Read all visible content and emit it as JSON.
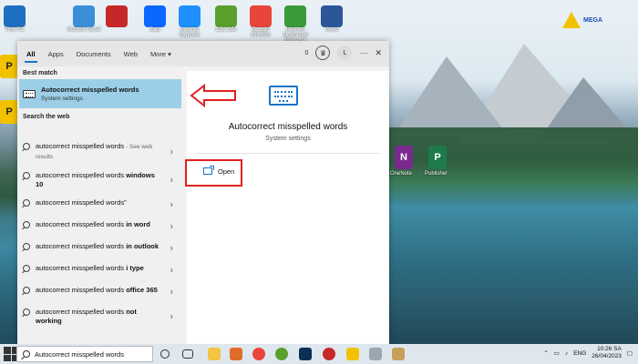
{
  "desktop": {
    "top_icons": [
      {
        "name": "this-pc-icon",
        "label": "This PC",
        "color": "#1e6fbf"
      },
      {
        "name": "control-panel-icon",
        "label": "Control Panel",
        "color": "#3a8fd8"
      },
      {
        "name": "app-icon-2",
        "label": "",
        "color": "#c62828"
      },
      {
        "name": "zalo-icon",
        "label": "Zalo",
        "color": "#0a68ff"
      },
      {
        "name": "internet-explorer-icon",
        "label": "Internet Explorer",
        "color": "#1e90ff"
      },
      {
        "name": "coc-coc-icon",
        "label": "Cốc Cốc",
        "color": "#5aa02c"
      },
      {
        "name": "chrome-icon",
        "label": "Google Chrome",
        "color": "#e8453c"
      },
      {
        "name": "idm-icon",
        "label": "Internet Download Manager",
        "color": "#3a9a3a"
      },
      {
        "name": "word-icon",
        "label": "Word",
        "color": "#2b579a"
      }
    ],
    "logo_text": "MEGA"
  },
  "start": {
    "tabs": [
      "All",
      "Apps",
      "Documents",
      "Web",
      "More ▾"
    ],
    "badge_count": "0",
    "user_initial": "L",
    "more_dots": "···",
    "close": "✕",
    "best_match_label": "Best match",
    "best_match": {
      "title": "Autocorrect misspelled words",
      "subtitle": "System settings"
    },
    "search_web_label": "Search the web",
    "web_results": [
      {
        "text": "autocorrect misspelled words",
        "bold": "",
        "suffix": " - See web results"
      },
      {
        "text": "autocorrect misspelled words ",
        "bold": "windows 10",
        "suffix": ""
      },
      {
        "text": "autocorrect misspelled words\"",
        "bold": "",
        "suffix": ""
      },
      {
        "text": "autocorrect misspelled words ",
        "bold": "in word",
        "suffix": ""
      },
      {
        "text": "autocorrect misspelled words ",
        "bold": "in outlook",
        "suffix": ""
      },
      {
        "text": "autocorrect misspelled words ",
        "bold": "i type",
        "suffix": ""
      },
      {
        "text": "autocorrect misspelled words ",
        "bold": "office 365",
        "suffix": ""
      },
      {
        "text": "autocorrect misspelled words ",
        "bold": "not working",
        "suffix": ""
      }
    ],
    "detail": {
      "title": "Autocorrect misspelled words",
      "subtitle": "System settings",
      "open_label": "Open"
    }
  },
  "taskbar": {
    "search_value": "Autocorrect misspelled words",
    "lang": "ENG",
    "time": "10:26 SA",
    "date": "26/04/2023"
  },
  "colors": {
    "accent": "#1a73c8",
    "highlight": "#9ccfe7",
    "annotation_red": "#e02020"
  }
}
